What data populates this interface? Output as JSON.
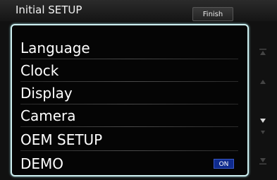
{
  "header": {
    "title": "Initial SETUP",
    "finish_label": "Finish"
  },
  "menu": {
    "items": [
      {
        "label": "Language"
      },
      {
        "label": "Clock"
      },
      {
        "label": "Display"
      },
      {
        "label": "Camera"
      },
      {
        "label": "OEM SETUP"
      },
      {
        "label": "DEMO",
        "badge": "ON"
      }
    ]
  },
  "scrollbar": {
    "icons": [
      "scroll-top-icon",
      "scroll-up-icon",
      "scroll-down-icon",
      "scroll-page-down-icon",
      "scroll-bottom-icon"
    ]
  },
  "colors": {
    "panel_border": "#cdeff0",
    "badge_on": "#0f2b8e",
    "background": "#111111"
  }
}
